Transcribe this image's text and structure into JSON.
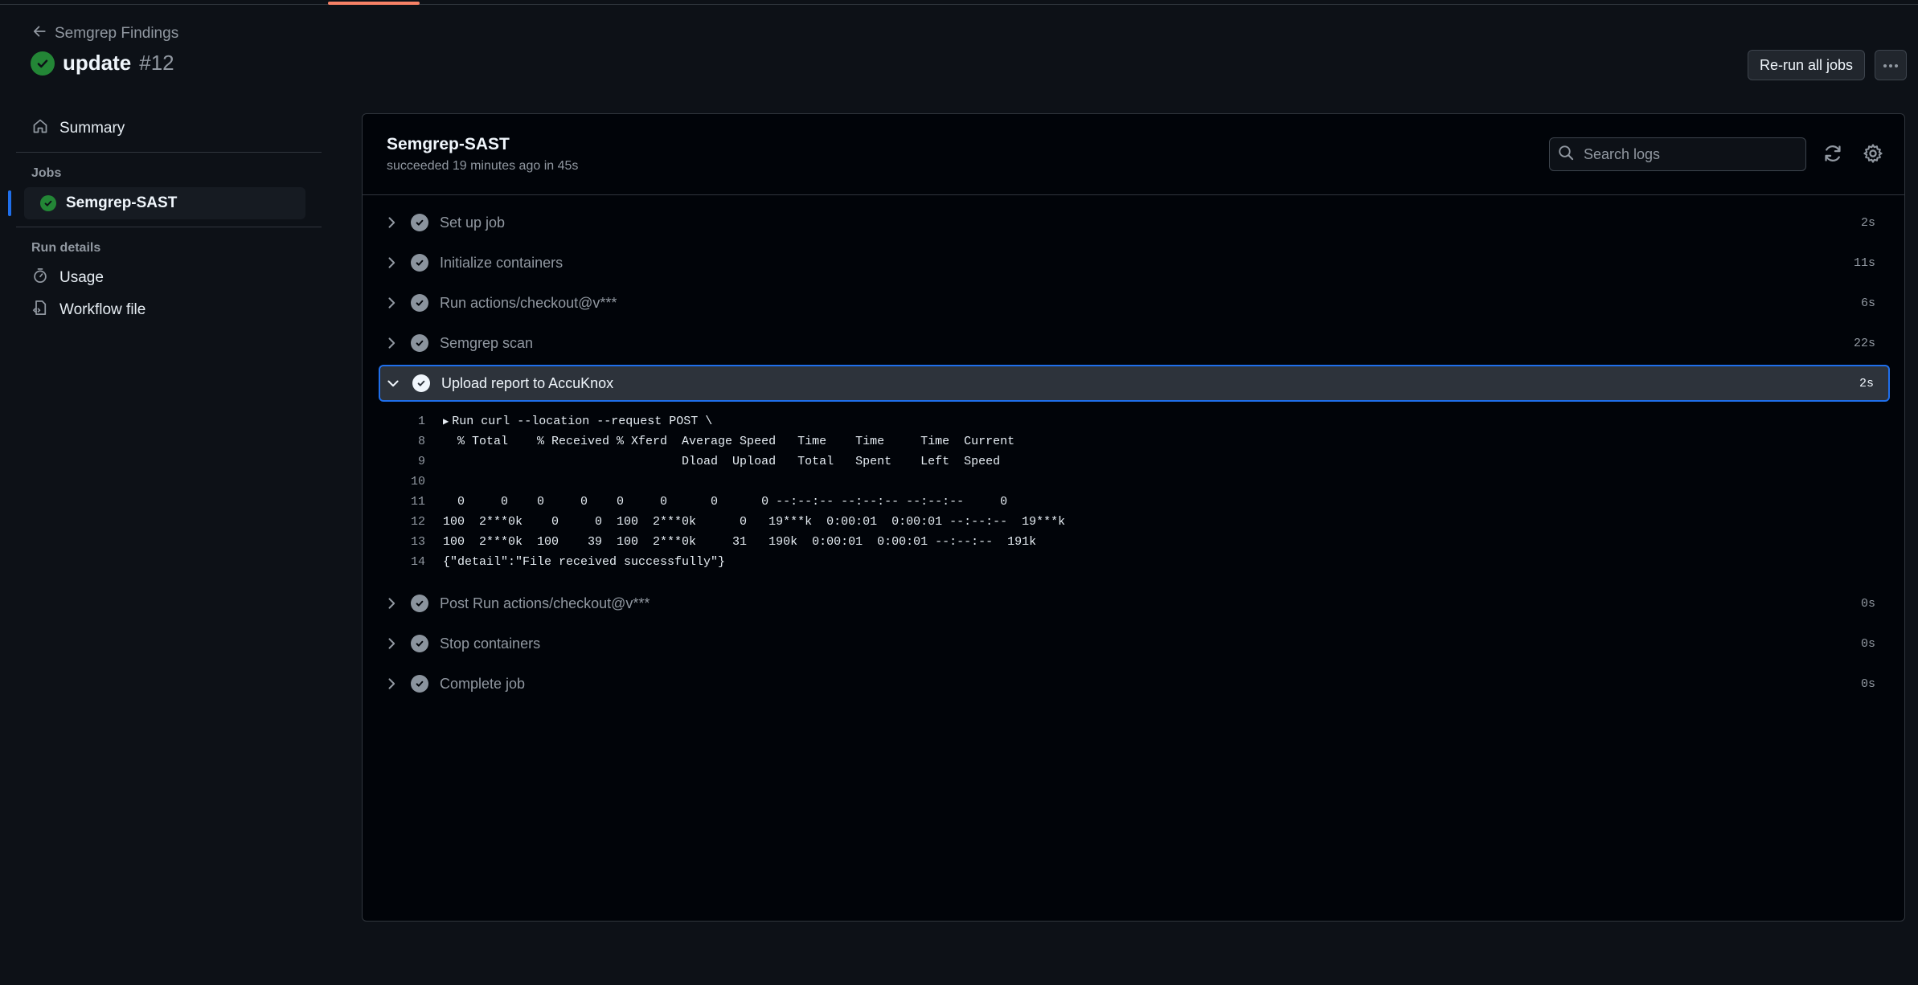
{
  "header": {
    "back_label": "Semgrep Findings",
    "run_name": "update",
    "run_number": "#12",
    "rerun_label": "Re-run all jobs"
  },
  "sidebar": {
    "summary_label": "Summary",
    "jobs_heading": "Jobs",
    "job_label": "Semgrep-SAST",
    "run_details_heading": "Run details",
    "usage_label": "Usage",
    "workflow_file_label": "Workflow file"
  },
  "job": {
    "title": "Semgrep-SAST",
    "status": "succeeded 19 minutes ago in 45s",
    "search_placeholder": "Search logs"
  },
  "steps": [
    {
      "label": "Set up job",
      "duration": "2s"
    },
    {
      "label": "Initialize containers",
      "duration": "11s"
    },
    {
      "label": "Run actions/checkout@v***",
      "duration": "6s"
    },
    {
      "label": "Semgrep scan",
      "duration": "22s"
    },
    {
      "label": "Upload report to AccuKnox",
      "duration": "2s"
    },
    {
      "label": "Post Run actions/checkout@v***",
      "duration": "0s"
    },
    {
      "label": "Stop containers",
      "duration": "0s"
    },
    {
      "label": "Complete job",
      "duration": "0s"
    }
  ],
  "log_lines": [
    {
      "num": "1",
      "text": "Run curl --location --request POST \\"
    },
    {
      "num": "8",
      "text": "  % Total    % Received % Xferd  Average Speed   Time    Time     Time  Current"
    },
    {
      "num": "9",
      "text": "                                 Dload  Upload   Total   Spent    Left  Speed"
    },
    {
      "num": "10",
      "text": ""
    },
    {
      "num": "11",
      "text": "  0     0    0     0    0     0      0      0 --:--:-- --:--:-- --:--:--     0"
    },
    {
      "num": "12",
      "text": "100  2***0k    0     0  100  2***0k      0   19***k  0:00:01  0:00:01 --:--:--  19***k"
    },
    {
      "num": "13",
      "text": "100  2***0k  100    39  100  2***0k     31   190k  0:00:01  0:00:01 --:--:--  191k"
    },
    {
      "num": "14",
      "text": "{\"detail\":\"File received successfully\"}"
    }
  ],
  "colors": {
    "background": "#0d1117",
    "accent_blue": "#1f6feb",
    "success_green": "#238636",
    "tab_underline": "#f78166"
  }
}
